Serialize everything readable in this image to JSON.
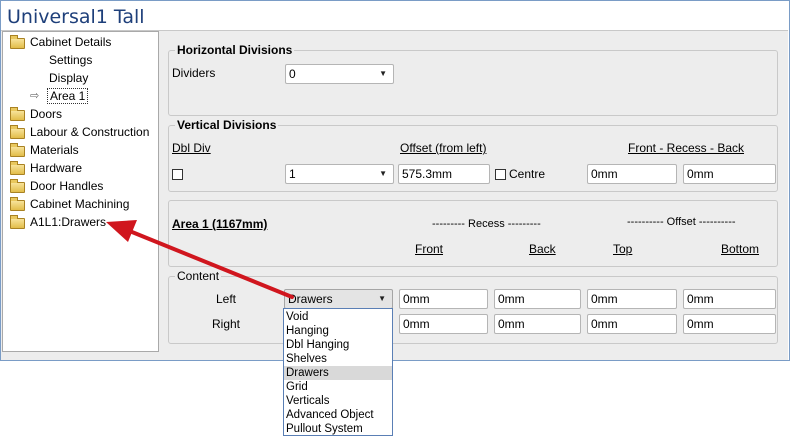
{
  "window": {
    "title": "Universal1 Tall"
  },
  "tree": {
    "items": [
      {
        "label": "Cabinet Details",
        "level": 0,
        "icon": "folder-icon"
      },
      {
        "label": "Settings",
        "level": 1,
        "icon": ""
      },
      {
        "label": "Display",
        "level": 1,
        "icon": ""
      },
      {
        "label": "Area 1",
        "level": 1,
        "icon": "arrow-icon",
        "selected": true
      },
      {
        "label": "Doors",
        "level": 0,
        "icon": "folder-icon"
      },
      {
        "label": "Labour & Construction",
        "level": 0,
        "icon": "folder-icon"
      },
      {
        "label": "Materials",
        "level": 0,
        "icon": "folder-icon"
      },
      {
        "label": "Hardware",
        "level": 0,
        "icon": "folder-icon"
      },
      {
        "label": "Door Handles",
        "level": 0,
        "icon": "folder-icon"
      },
      {
        "label": "Cabinet Machining",
        "level": 0,
        "icon": "folder-icon"
      },
      {
        "label": "A1L1:Drawers",
        "level": 0,
        "icon": "folder-icon"
      }
    ]
  },
  "horizontal": {
    "title": "Horizontal Divisions",
    "dividers_label": "Dividers",
    "dividers_value": "0"
  },
  "vertical": {
    "title": "Vertical Divisions",
    "dbl_div_label": "Dbl Div",
    "offset_label": "Offset (from left)",
    "front_recess_back_label": "Front - Recess - Back",
    "count_value": "1",
    "offset_value": "575.3mm",
    "centre_label": "Centre",
    "front_value": "0mm",
    "back_value": "0mm"
  },
  "area": {
    "title": "Area 1 (1167mm)",
    "recess_header": "--------- Recess ---------",
    "offset_header": "---------- Offset ----------",
    "front_label": "Front",
    "back_label": "Back",
    "top_label": "Top",
    "bottom_label": "Bottom"
  },
  "content": {
    "title": "Content",
    "left_label": "Left",
    "right_label": "Right",
    "left_selected": "Drawers",
    "left_values": [
      "0mm",
      "0mm",
      "0mm",
      "0mm"
    ],
    "right_values": [
      "0mm",
      "0mm",
      "0mm",
      "0mm"
    ]
  },
  "dropdown": {
    "options": [
      "Void",
      "Hanging",
      "Dbl Hanging",
      "Shelves",
      "Drawers",
      "Grid",
      "Verticals",
      "Advanced Object",
      "Pullout System"
    ],
    "selected": "Drawers"
  },
  "colors": {
    "title_text": "#1e3f7a",
    "annotation_arrow": "#d0161e",
    "dropdown_border": "#5a7fb5"
  }
}
